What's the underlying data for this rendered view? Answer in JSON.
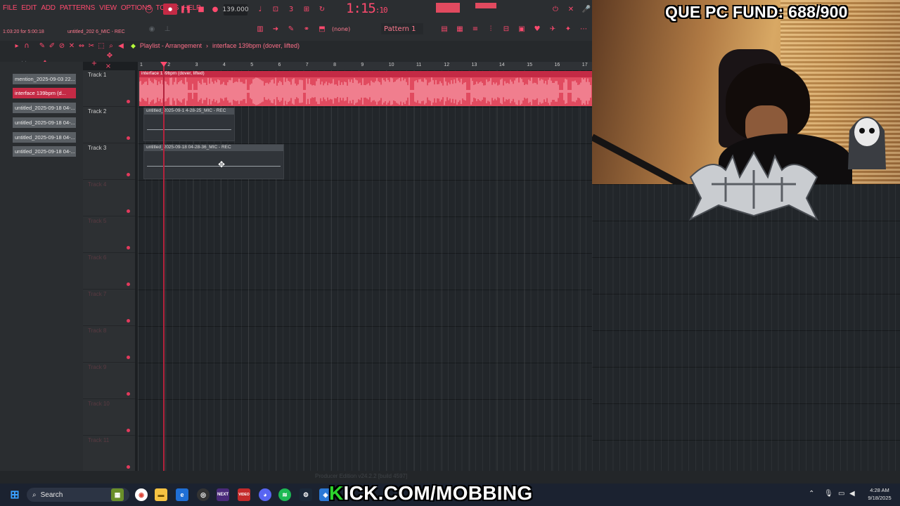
{
  "menu": [
    "FILE",
    "EDIT",
    "ADD",
    "PATTERNS",
    "VIEW",
    "OPTIONS",
    "TOOLS",
    "HELP"
  ],
  "toolbar": {
    "tempo": "139.000",
    "time_main": "1:15",
    "time_sub": ":10",
    "pattern": "Pattern 1",
    "none_selector": "(none)",
    "hint_left": "1:03:20 for 5:00:18",
    "hint_file": "untitled_202 6_MIC - REC"
  },
  "breadcrumb": {
    "part1": "Playlist - Arrangement",
    "part2": "interface 139bpm (dover, lifted)"
  },
  "picker": [
    {
      "label": "mention_2025-09-03 22...",
      "active": false
    },
    {
      "label": "interface 139bpm (d...",
      "active": true
    },
    {
      "label": "untitled_2025-09-18 04-...",
      "active": false
    },
    {
      "label": "untitled_2025-09-18 04-...",
      "active": false
    },
    {
      "label": "untitled_2025-09-18 04-...",
      "active": false
    },
    {
      "label": "untitled_2025-09-18 04-...",
      "active": false
    }
  ],
  "tracks": [
    {
      "name": "Track 1",
      "dim": false
    },
    {
      "name": "Track 2",
      "dim": false
    },
    {
      "name": "Track 3",
      "dim": false
    },
    {
      "name": "Track 4",
      "dim": true
    },
    {
      "name": "Track 5",
      "dim": true
    },
    {
      "name": "Track 6",
      "dim": true
    },
    {
      "name": "Track 7",
      "dim": true
    },
    {
      "name": "Track 8",
      "dim": true
    },
    {
      "name": "Track 9",
      "dim": true
    },
    {
      "name": "Track 10",
      "dim": true
    },
    {
      "name": "Track 11",
      "dim": true
    }
  ],
  "ruler": [
    "1",
    "2",
    "3",
    "4",
    "5",
    "6",
    "7",
    "8",
    "9",
    "10",
    "11",
    "12",
    "13",
    "14",
    "15",
    "16",
    "17"
  ],
  "clips": {
    "main": "interface 139bpm (dover, lifted)",
    "clip2": "untitled_2025-09-1 4-28-25_MIC - REC",
    "clip3": "untitled_2025-09-18 04-28-36_MIC - REC"
  },
  "status_text": "Producer Edition v24.2.2 [build 4597]",
  "overlay": {
    "fund": "QUE PC FUND: 688/900",
    "kick_k": "K",
    "kick_rest": "ICK.COM/MOBBING"
  },
  "taskbar": {
    "search": "Search",
    "time": "4:28 AM",
    "date": "9/18/2025"
  },
  "colors": {
    "accent": "#ff4a6e",
    "clip_main": "#e14a5f",
    "kick_green": "#2cd42c"
  }
}
